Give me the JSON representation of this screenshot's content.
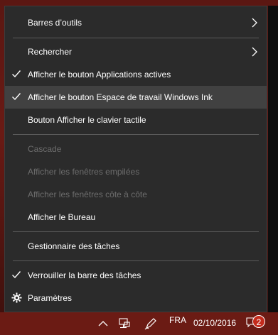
{
  "menu": {
    "items": [
      {
        "label": "Barres d’outils",
        "submenu": true,
        "checked": false,
        "disabled": false
      },
      {
        "label": "Rechercher",
        "submenu": true,
        "checked": false,
        "disabled": false
      },
      {
        "label": "Afficher le bouton Applications actives",
        "submenu": false,
        "checked": true,
        "disabled": false
      },
      {
        "label": "Afficher le bouton Espace de travail Windows Ink",
        "submenu": false,
        "checked": true,
        "disabled": false,
        "highlighted": true
      },
      {
        "label": "Bouton Afficher le clavier tactile",
        "submenu": false,
        "checked": false,
        "disabled": false
      },
      {
        "label": "Cascade",
        "submenu": false,
        "checked": false,
        "disabled": true
      },
      {
        "label": "Afficher les fenêtres empilées",
        "submenu": false,
        "checked": false,
        "disabled": true
      },
      {
        "label": "Afficher les fenêtres côte à côte",
        "submenu": false,
        "checked": false,
        "disabled": true
      },
      {
        "label": "Afficher le Bureau",
        "submenu": false,
        "checked": false,
        "disabled": false
      },
      {
        "label": "Gestionnaire des tâches",
        "submenu": false,
        "checked": false,
        "disabled": false
      },
      {
        "label": "Verrouiller la barre des tâches",
        "submenu": false,
        "checked": true,
        "disabled": false
      },
      {
        "label": "Paramètres",
        "submenu": false,
        "checked": false,
        "disabled": false,
        "icon": "gear-icon"
      }
    ]
  },
  "taskbar": {
    "language": "FRA",
    "date": "02/10/2016",
    "notification_count": "2",
    "icons": [
      "chevron-up-icon",
      "network-icon",
      "pen-icon"
    ]
  },
  "colors": {
    "menu_bg": "#2b2b2b",
    "highlight": "#414141",
    "disabled_text": "#6d6d6d",
    "taskbar_bg": "#6b1b14"
  }
}
